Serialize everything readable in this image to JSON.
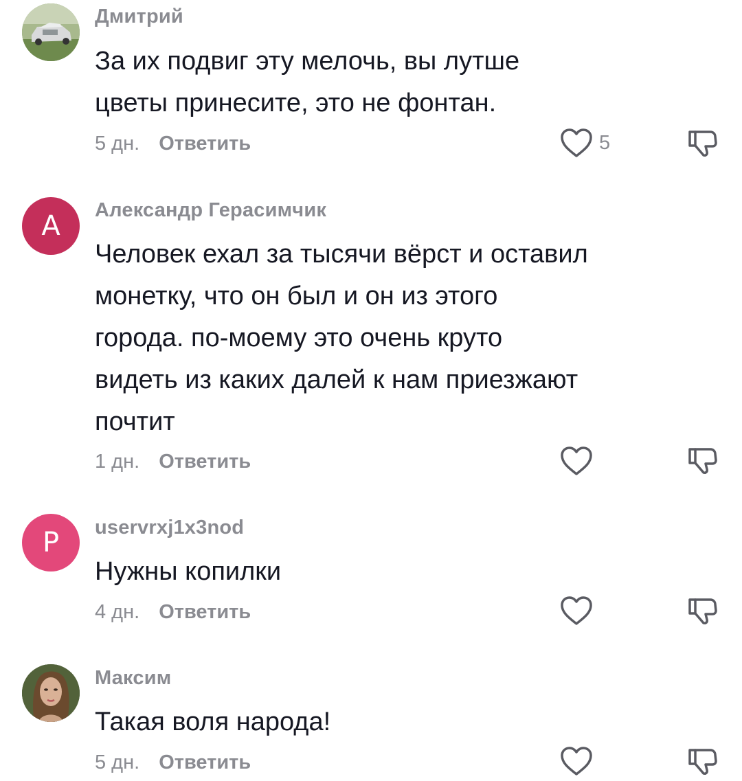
{
  "colors": {
    "secondary_text": "#8a8b91",
    "primary_text": "#161823",
    "avatar_a": "#c42f5a",
    "avatar_p": "#e3487a"
  },
  "comments": [
    {
      "avatar": {
        "type": "photo",
        "description_icon": "car-photo-avatar"
      },
      "username": "Дмитрий",
      "lines": [
        "За их подвиг эту мелочь, вы лутше",
        "цветы принесите, это не фонтан."
      ],
      "date": "5 дн.",
      "reply": "Ответить",
      "likes": "5",
      "like_icon": "heart-icon",
      "dislike_icon": "thumbs-down-icon"
    },
    {
      "avatar": {
        "type": "letter",
        "letter": "A"
      },
      "username": "Александр Герасимчик",
      "lines": [
        "Человек ехал за тысячи вёрст и оставил",
        "монетку, что он был и он из этого",
        "города. по-моему это очень круто",
        "видеть из каких далей к нам приезжают",
        "почтит"
      ],
      "date": "1 дн.",
      "reply": "Ответить",
      "like_icon": "heart-icon",
      "dislike_icon": "thumbs-down-icon"
    },
    {
      "avatar": {
        "type": "letter",
        "letter": "P"
      },
      "username": "uservrxj1x3nod",
      "lines": [
        "Нужны копилки"
      ],
      "date": "4 дн.",
      "reply": "Ответить",
      "like_icon": "heart-icon",
      "dislike_icon": "thumbs-down-icon"
    },
    {
      "avatar": {
        "type": "photo",
        "description_icon": "woman-photo-avatar"
      },
      "username": "Максим",
      "lines": [
        "Такая воля народа!"
      ],
      "date": "5 дн.",
      "reply": "Ответить",
      "like_icon": "heart-icon",
      "dislike_icon": "thumbs-down-icon"
    }
  ]
}
